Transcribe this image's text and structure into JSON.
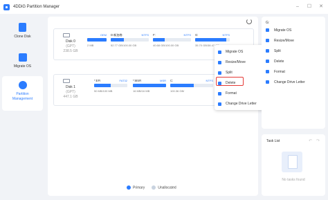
{
  "app": {
    "title": "4DDiG Partition Manager"
  },
  "window_controls": [
    "–",
    "☐",
    "✕"
  ],
  "sidebar": {
    "items": [
      {
        "label": "Clone Disk"
      },
      {
        "label": "Migrate OS"
      },
      {
        "label": "Partition Management",
        "label_line1": "Partition",
        "label_line2": "Management",
        "active": true
      }
    ]
  },
  "disks": [
    {
      "name": "Disk 0",
      "type": "(GPT)",
      "size": "238.5 GB",
      "partitions": [
        {
          "name": "",
          "fs": "OEM",
          "size": "2 MB",
          "used": 1.0
        },
        {
          "name": "D:新加卷",
          "fs": "NTFS",
          "size": "52.77 GB/100.00 GB",
          "used": 0.35
        },
        {
          "name": "F:",
          "fs": "NTFS",
          "size": "40.68 GB/100.00 GB",
          "used": 0.3
        },
        {
          "name": "G:",
          "fs": "NTFS",
          "size": "35.70 GB/38.47 GB",
          "used": 0.9
        }
      ]
    },
    {
      "name": "Disk 1",
      "type": "(GPT)",
      "size": "447.1 GB",
      "partitions": [
        {
          "name": "*:EFI",
          "fs": "FAT32",
          "size": "50 MB/100 MB",
          "used": 0.5
        },
        {
          "name": "*:MSR",
          "fs": "MSR",
          "size": "16 MB/16 MB",
          "used": 1.0
        },
        {
          "name": "C:",
          "fs": "NTFS",
          "size": "100.36 GB/",
          "used": 0.55
        }
      ]
    }
  ],
  "legend": {
    "primary": "Primary",
    "unallocated": "Unallocated"
  },
  "context_menu": {
    "items": [
      "Migrate OS",
      "Resize/Move",
      "Split",
      "Delete",
      "Format",
      "Change Drive Letter"
    ]
  },
  "operations_panel": {
    "title": "G:",
    "items": [
      "Migrate OS",
      "Resize/Move",
      "Split",
      "Delete",
      "Format",
      "Change Drive Letter"
    ]
  },
  "task_list": {
    "title": "Task List",
    "empty_text": "No tasks found"
  },
  "colors": {
    "accent": "#2b7cff",
    "highlight": "#e53935",
    "unallocated": "#c9d3e0"
  }
}
